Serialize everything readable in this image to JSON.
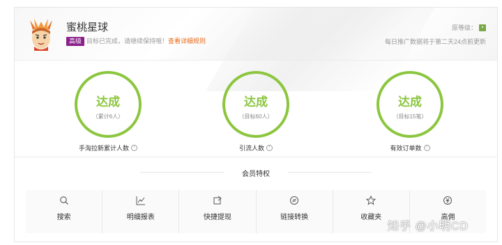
{
  "header": {
    "shop_name": "蜜桃星球",
    "level_badge": "高级",
    "target_text": "目标已完成，请继续保持哦！",
    "rule_link": "查看详细规则",
    "original_level_label": "原等级：",
    "update_note": "每日推广数据将于第二天24点前更新"
  },
  "stats": [
    {
      "status": "达成",
      "sub": "（累计6人）",
      "label": "手淘拉新累计人数"
    },
    {
      "status": "达成",
      "sub": "（目标60人）",
      "label": "引流人数"
    },
    {
      "status": "达成",
      "sub": "（目标15笔）",
      "label": "有效订单数"
    }
  ],
  "privileges": {
    "title": "会员特权",
    "items": [
      {
        "label": "搜索",
        "icon": "search-icon"
      },
      {
        "label": "明细报表",
        "icon": "chart-icon"
      },
      {
        "label": "快捷提现",
        "icon": "withdraw-icon"
      },
      {
        "label": "链接转换",
        "icon": "link-convert-icon"
      },
      {
        "label": "收藏夹",
        "icon": "star-icon"
      },
      {
        "label": "高佣",
        "icon": "commission-icon"
      }
    ]
  },
  "watermark": "知乎 @小明CD",
  "colors": {
    "accent_green": "#8cc63f",
    "badge_purple": "#8a1f8c",
    "link_orange": "#e86a17"
  }
}
